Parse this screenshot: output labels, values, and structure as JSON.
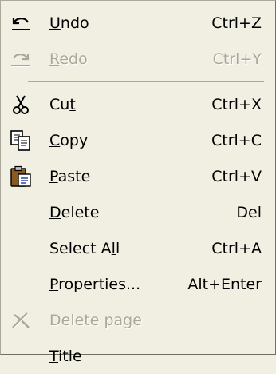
{
  "menu": {
    "items": [
      {
        "kind": "item",
        "name": "undo",
        "icon": "undo-icon",
        "pre": "",
        "key": "U",
        "post": "ndo",
        "shortcut": "Ctrl+Z",
        "enabled": true
      },
      {
        "kind": "item",
        "name": "redo",
        "icon": "redo-icon",
        "pre": "",
        "key": "R",
        "post": "edo",
        "shortcut": "Ctrl+Y",
        "enabled": false
      },
      {
        "kind": "separator"
      },
      {
        "kind": "item",
        "name": "cut",
        "icon": "scissors-icon",
        "pre": "Cu",
        "key": "t",
        "post": "",
        "shortcut": "Ctrl+X",
        "enabled": true
      },
      {
        "kind": "item",
        "name": "copy",
        "icon": "copy-icon",
        "pre": "",
        "key": "C",
        "post": "opy",
        "shortcut": "Ctrl+C",
        "enabled": true
      },
      {
        "kind": "item",
        "name": "paste",
        "icon": "clipboard-paste-icon",
        "pre": "",
        "key": "P",
        "post": "aste",
        "shortcut": "Ctrl+V",
        "enabled": true
      },
      {
        "kind": "item",
        "name": "delete",
        "icon": "",
        "pre": "",
        "key": "D",
        "post": "elete",
        "shortcut": "Del",
        "enabled": true
      },
      {
        "kind": "item",
        "name": "select-all",
        "icon": "",
        "pre": "Select A",
        "key": "l",
        "post": "l",
        "shortcut": "Ctrl+A",
        "enabled": true
      },
      {
        "kind": "item",
        "name": "properties",
        "icon": "",
        "pre": "",
        "key": "P",
        "post": "roperties...",
        "shortcut": "Alt+Enter",
        "enabled": true
      },
      {
        "kind": "item",
        "name": "delete-page",
        "icon": "delete-x-icon",
        "pre": "Delete pa",
        "key": "g",
        "post": "e",
        "shortcut": "",
        "enabled": false
      },
      {
        "kind": "item",
        "name": "title",
        "icon": "",
        "pre": "",
        "key": "T",
        "post": "itle",
        "shortcut": "",
        "enabled": true
      }
    ]
  },
  "colors": {
    "menu_background": "#f1efe2",
    "border": "#aca899",
    "disabled_text": "#aca899",
    "text": "#000000"
  }
}
